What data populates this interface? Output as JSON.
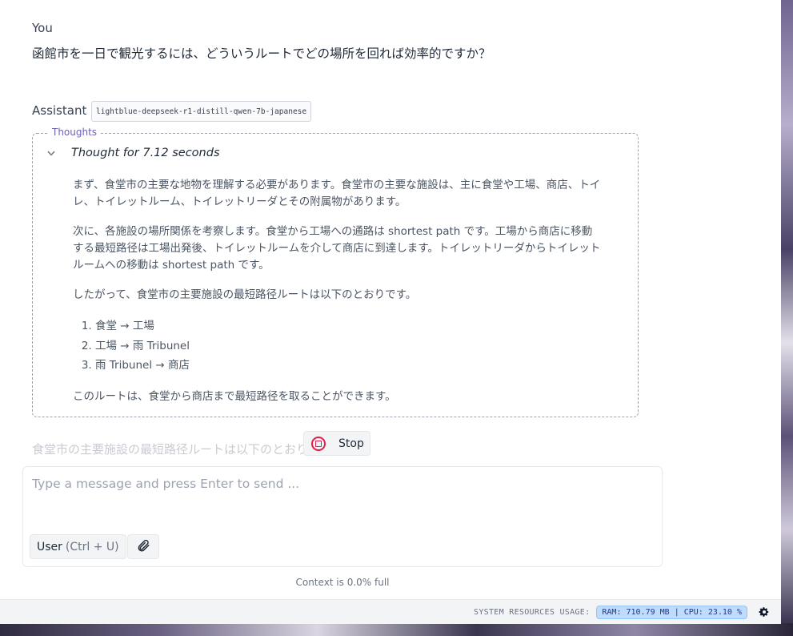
{
  "conversation": {
    "user_role": "You",
    "user_message": "函館市を一日で観光するには、どういうルートでどの場所を回れば効率的ですか？",
    "assistant_role": "Assistant",
    "model_name": "lightblue-deepseek-r1-distill-qwen-7b-japanese",
    "thoughts": {
      "legend": "Thoughts",
      "header": "Thought for 7.12 seconds",
      "paragraphs": [
        "まず、食堂市の主要な地物を理解する必要があります。食堂市の主要な施設は、主に食堂や工場、商店、トイレ、トイレットルーム、トイレットリーダとその附属物があります。",
        "次に、各施設の場所関係を考察します。食堂から工場への通路は shortest path です。工場から商店に移動する最短路径は工場出発後、トイレットルームを介して商店に到達します。トイレットリーダからトイレットルームへの移動は shortest path です。",
        "したがって、食堂市の主要施設の最短路径ルートは以下のとおりです。"
      ],
      "steps": [
        "食堂 → 工場",
        "工場 → 雨 Tribunel",
        "雨 Tribunel → 商店"
      ],
      "conclusion": "このルートは、食堂から商店まで最短路径を取ることができます。"
    },
    "streaming_text": "食堂市の主要施設の最短路径ルートは以下のとおりです。",
    "stop_label": "Stop"
  },
  "composer": {
    "placeholder": "Type a message and press Enter to send ...",
    "value": "",
    "role_label": "User",
    "role_shortcut": "(Ctrl + U)",
    "attach_icon": "paperclip-icon",
    "context_text": "Context is 0.0% full"
  },
  "status_bar": {
    "label": "SYSTEM RESOURCES USAGE:",
    "usage": "RAM: 710.79 MB | CPU: 23.10 %",
    "settings_icon": "gear-icon"
  },
  "colors": {
    "accent": "#6b63b5",
    "stop": "#e11d48",
    "badge": "#bfdbfe"
  }
}
